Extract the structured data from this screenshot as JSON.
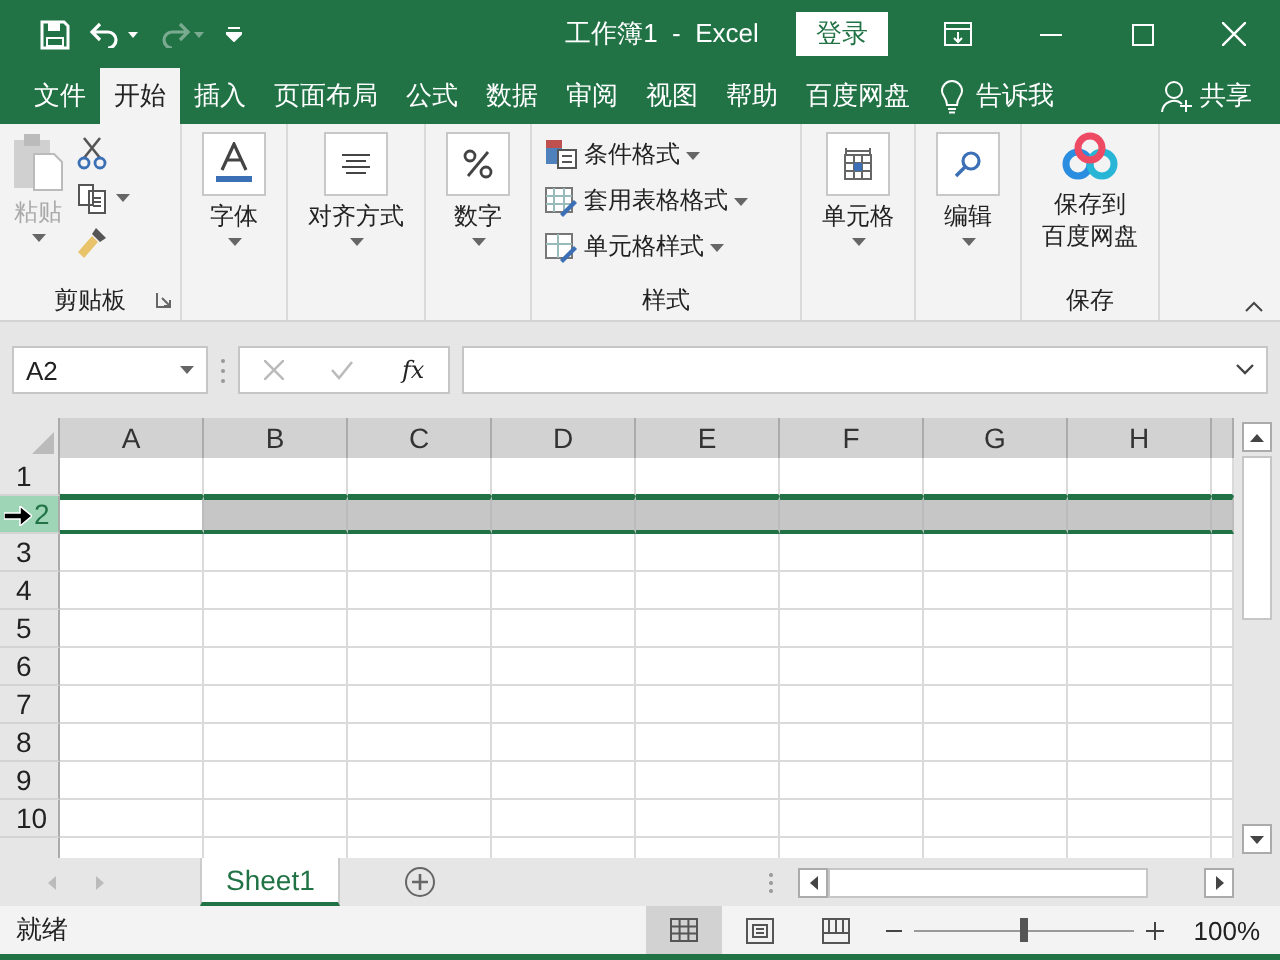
{
  "title_bar": {
    "title": "工作簿1  -  Excel",
    "login_button": "登录"
  },
  "menu_tabs": [
    {
      "label": "文件",
      "selected": false
    },
    {
      "label": "开始",
      "selected": true
    },
    {
      "label": "插入",
      "selected": false
    },
    {
      "label": "页面布局",
      "selected": false
    },
    {
      "label": "公式",
      "selected": false
    },
    {
      "label": "数据",
      "selected": false
    },
    {
      "label": "审阅",
      "selected": false
    },
    {
      "label": "视图",
      "selected": false
    },
    {
      "label": "帮助",
      "selected": false
    },
    {
      "label": "百度网盘",
      "selected": false
    }
  ],
  "tell_me": "告诉我",
  "share": "共享",
  "ribbon": {
    "clipboard": {
      "paste": "粘贴",
      "label": "剪贴板"
    },
    "font": "字体",
    "alignment": "对齐方式",
    "number": "数字",
    "styles": {
      "items": [
        "条件格式",
        "套用表格格式",
        "单元格样式"
      ],
      "label": "样式"
    },
    "cells": "单元格",
    "editing": "编辑",
    "save": {
      "button_lines": [
        "保存到",
        "百度网盘"
      ],
      "label": "保存"
    }
  },
  "formula_bar": {
    "name_box": "A2",
    "fx": "fx"
  },
  "columns": [
    "A",
    "B",
    "C",
    "D",
    "E",
    "F",
    "G",
    "H"
  ],
  "rows": [
    {
      "number": "1",
      "selected": false
    },
    {
      "number": "2",
      "selected": true
    },
    {
      "number": "3",
      "selected": false
    },
    {
      "number": "4",
      "selected": false
    },
    {
      "number": "5",
      "selected": false
    },
    {
      "number": "6",
      "selected": false
    },
    {
      "number": "7",
      "selected": false
    },
    {
      "number": "8",
      "selected": false
    },
    {
      "number": "9",
      "selected": false
    },
    {
      "number": "10",
      "selected": false
    }
  ],
  "sheet_tabs": [
    {
      "label": "Sheet1",
      "selected": true
    }
  ],
  "status_bar": {
    "status": "就绪",
    "views": [
      {
        "kind": "normal",
        "selected": true
      },
      {
        "kind": "page_layout",
        "selected": false
      },
      {
        "kind": "page_break",
        "selected": false
      }
    ],
    "zoom": {
      "level": 0.5,
      "reading": "100%"
    }
  }
}
